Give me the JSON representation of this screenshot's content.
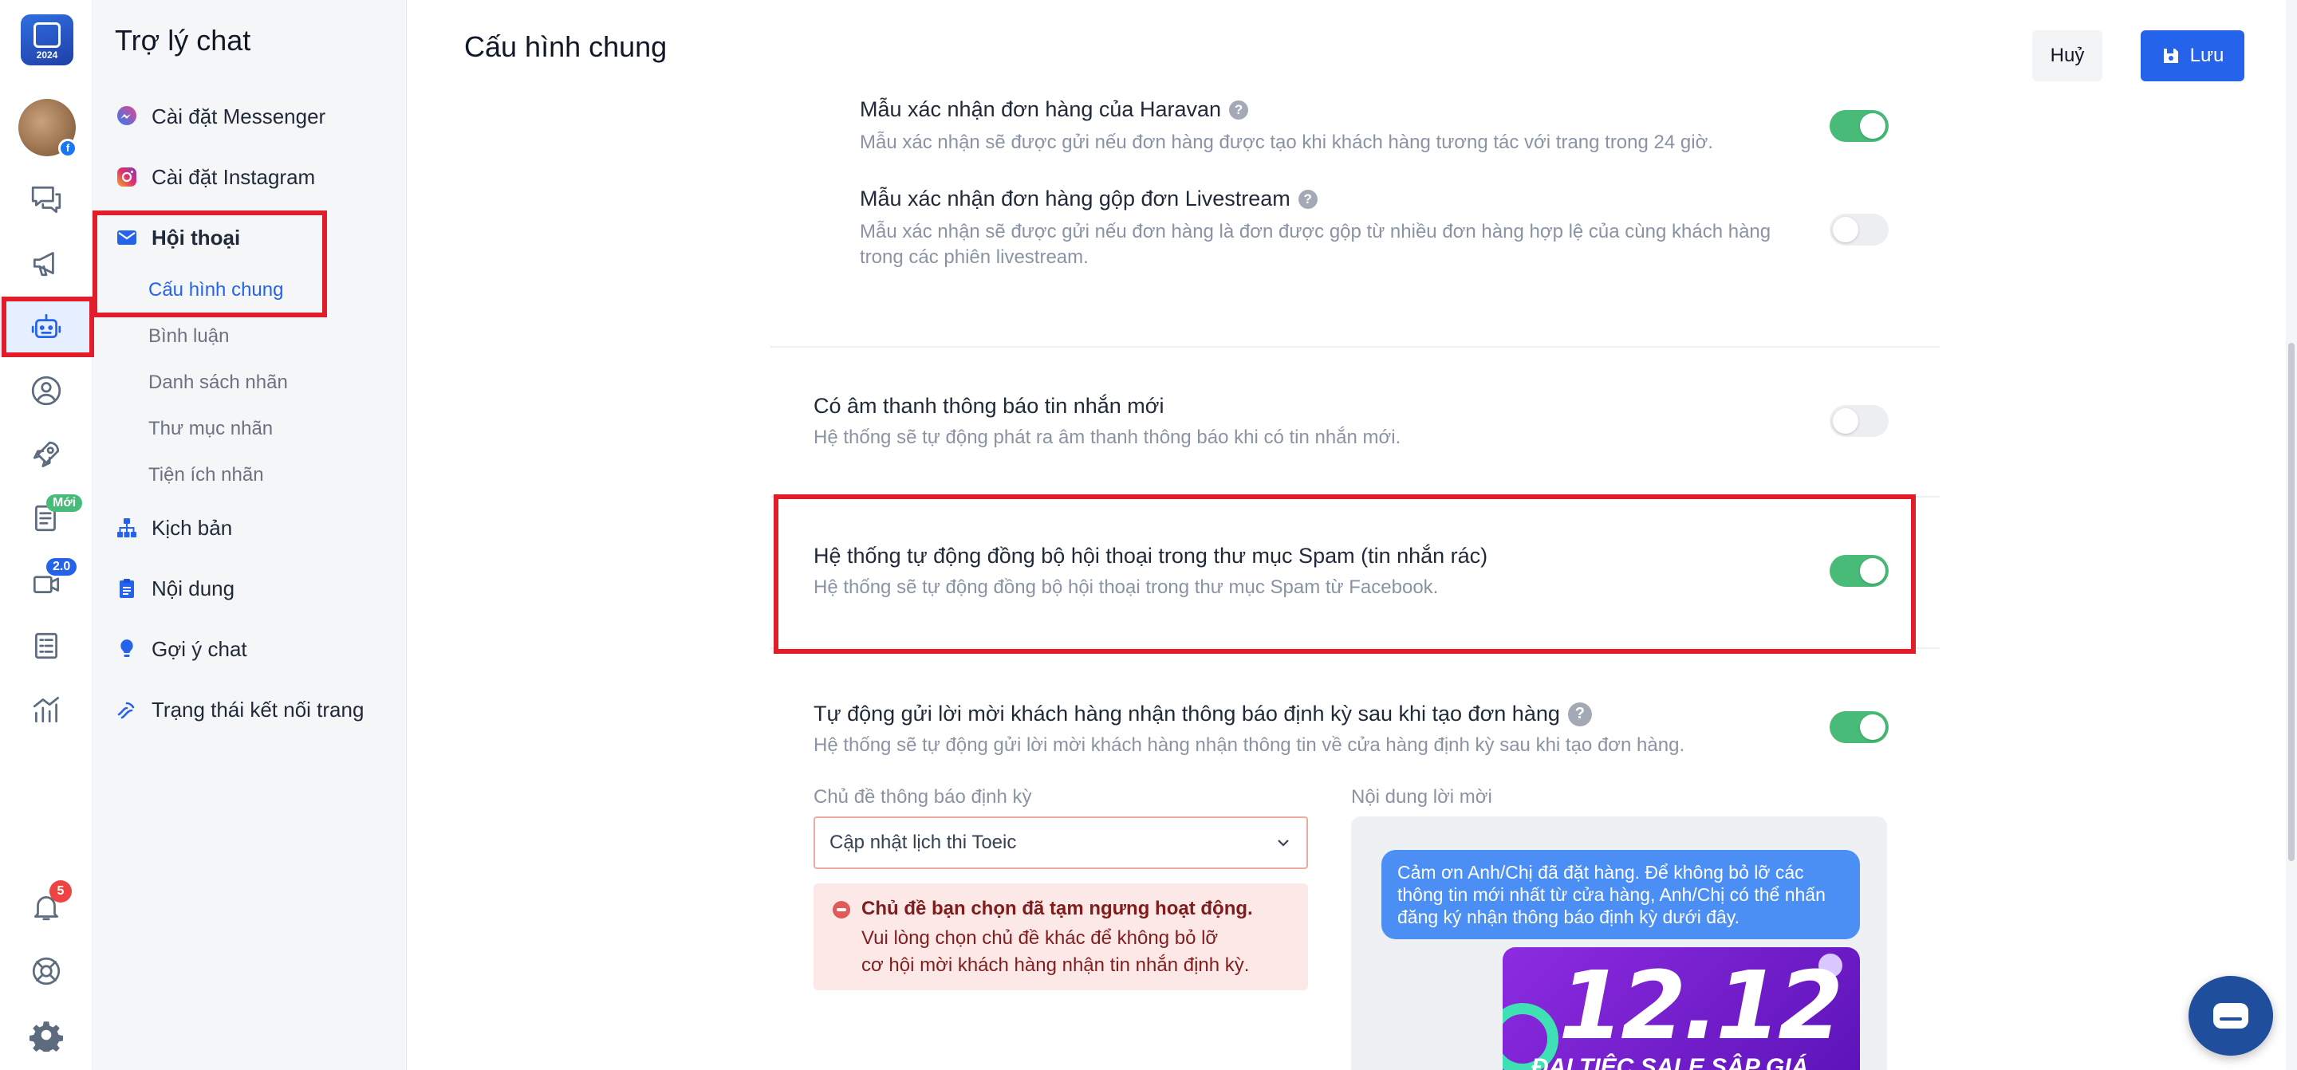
{
  "rail": {
    "logo_year": "2024",
    "badges": {
      "new": "Mới",
      "version": "2.0",
      "notifications": "5"
    }
  },
  "sidebar": {
    "title": "Trợ lý chat",
    "items": [
      {
        "label": "Cài đặt Messenger",
        "icon": "messenger-icon"
      },
      {
        "label": "Cài đặt Instagram",
        "icon": "instagram-icon"
      },
      {
        "label": "Hội thoại",
        "icon": "mail-icon"
      },
      {
        "label": "Kịch bản",
        "icon": "sitemap-icon"
      },
      {
        "label": "Nội dung",
        "icon": "clipboard-icon"
      },
      {
        "label": "Gợi ý chat",
        "icon": "lightbulb-icon"
      },
      {
        "label": "Trạng thái kết nối trang",
        "icon": "wave-icon"
      }
    ],
    "subitems": [
      "Cấu hình chung",
      "Bình luận",
      "Danh sách nhãn",
      "Thư mục nhãn",
      "Tiện ích nhãn"
    ]
  },
  "header": {
    "title": "Cấu hình chung",
    "cancel_label": "Huỷ",
    "save_label": "Lưu"
  },
  "settings": [
    {
      "title": "Mẫu xác nhận đơn hàng của Haravan",
      "desc": "Mẫu xác nhận sẽ được gửi nếu đơn hàng được tạo khi khách hàng tương tác với trang trong 24 giờ.",
      "enabled": true
    },
    {
      "title": "Mẫu xác nhận đơn hàng gộp đơn Livestream",
      "desc_line1": "Mẫu xác nhận sẽ được gửi nếu đơn hàng là đơn được gộp từ nhiều đơn hàng hợp lệ của cùng khách hàng",
      "desc_line2": "trong các phiên livestream.",
      "enabled": false
    },
    {
      "title": "Có âm thanh thông báo tin nhắn mới",
      "desc": "Hệ thống sẽ tự động phát ra âm thanh thông báo khi có tin nhắn mới.",
      "enabled": false
    },
    {
      "title": "Hệ thống tự động đồng bộ hội thoại trong thư mục Spam (tin nhắn rác)",
      "desc": "Hệ thống sẽ tự động đồng bộ hội thoại trong thư mục Spam từ Facebook.",
      "enabled": true
    },
    {
      "title": "Tự động gửi lời mời khách hàng nhận thông báo định kỳ sau khi tạo đơn hàng",
      "desc": "Hệ thống sẽ tự động gửi lời mời khách hàng nhận thông tin về cửa hàng định kỳ sau khi tạo đơn hàng.",
      "enabled": true
    }
  ],
  "periodic": {
    "topic_label": "Chủ đề thông báo định kỳ",
    "topic_value": "Cập nhật lịch thi Toeic",
    "error_title": "Chủ đề bạn chọn đã tạm ngưng hoạt động.",
    "error_line1": "Vui lòng chọn chủ đề khác để không bỏ lỡ",
    "error_line2": "cơ hội mời khách hàng nhận tin nhắn định kỳ.",
    "content_label": "Nội dung lời mời",
    "bubble_text": "Cảm ơn Anh/Chị đã đặt hàng. Để không bỏ lỡ các thông tin mới nhất từ cửa hàng, Anh/Chị có thể nhấn đăng ký nhận thông báo định kỳ dưới đây.",
    "promo_big": "12.12",
    "promo_small": "ĐẠI TIỆC SALE SẬP GIÁ"
  },
  "colors": {
    "accent": "#2563eb",
    "toggle_on": "#48bb78",
    "highlight": "#e11d2a"
  }
}
